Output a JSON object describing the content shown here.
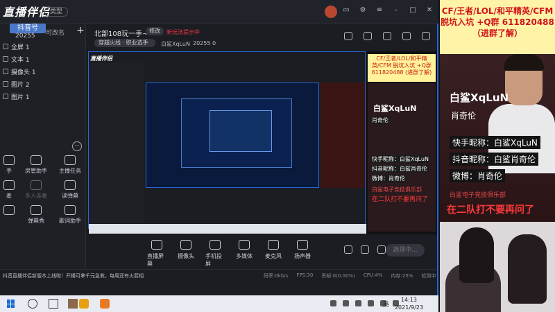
{
  "app": {
    "logo": "直播伴侣",
    "logo_sub": "抖音号",
    "type_btn": "类型"
  },
  "left": {
    "scene_num": "20255",
    "scene_edit": "可改名",
    "sources": [
      {
        "label": "全屏 1"
      },
      {
        "label": "文本 1"
      },
      {
        "label": "摄像头 1"
      },
      {
        "label": "图片 2"
      },
      {
        "label": "图片 1"
      }
    ],
    "tools": [
      {
        "label": "手"
      },
      {
        "label": "房管助手"
      },
      {
        "label": "主播任务"
      },
      {
        "label": "麦"
      },
      {
        "label": "多人连麦"
      },
      {
        "label": "读弹幕"
      },
      {
        "label": ""
      },
      {
        "label": "弹幕秀"
      },
      {
        "label": "歌词助手"
      }
    ]
  },
  "live": {
    "title": "北部108玩一手~",
    "modify": "修改",
    "not_live": "新玩法提示中",
    "category": "穿越火线 · 职业选手",
    "streamer": "白鲨XqLuN",
    "views": "20255",
    "fire": "0"
  },
  "preview": {
    "yellow_text": "CF/王者/LOL/和平精英/CFM 脱坑入坑 +Q群 611820488 (进群了解)",
    "name": "白鲨XqLuN",
    "real": "肖奇伦",
    "kuaishou": "快手昵称：白鲨XqLuN",
    "douyin": "抖音昵称：白鲨肖奇伦",
    "weibo": "微博：肖奇伦",
    "club": "白鲨电子竞技俱乐部",
    "warn": "在二队打不要再问了"
  },
  "bottombar": {
    "items": [
      {
        "label": "直播屏幕"
      },
      {
        "label": "摄像头"
      },
      {
        "label": "手机投屏"
      },
      {
        "label": "多媒体"
      },
      {
        "label": "麦克风"
      },
      {
        "label": "扬声器"
      }
    ],
    "select": "选择中..."
  },
  "status": {
    "marquee": "抖音直播伴侣新版本上线啦！开播可拿千元急救，每周还有火箭相",
    "stats": [
      {
        "label": "码率:0kb/s"
      },
      {
        "label": "FPS:30"
      },
      {
        "label": "丢帧:0(0.00%)"
      },
      {
        "label": "CPU:4%"
      },
      {
        "label": "内存:25%"
      },
      {
        "label": "检测中"
      }
    ]
  },
  "taskbar": {
    "lang": "英",
    "time": "14:13",
    "date": "2021/9/23"
  },
  "overlay": {
    "ad": "CF/王者/LOL/和平精英/CFM\n脱坑入坑 +Q群 611820488\n（进群了解）",
    "name": "白鲨XqLuN",
    "real": "肖奇伦",
    "kuaishou": "快手昵称：白鲨XqLuN",
    "douyin": "抖音昵称：白鲨肖奇伦",
    "weibo": "微博：肖奇伦",
    "club": "白鲨电子竞技俱乐部",
    "warn": "在二队打不要再问了"
  }
}
